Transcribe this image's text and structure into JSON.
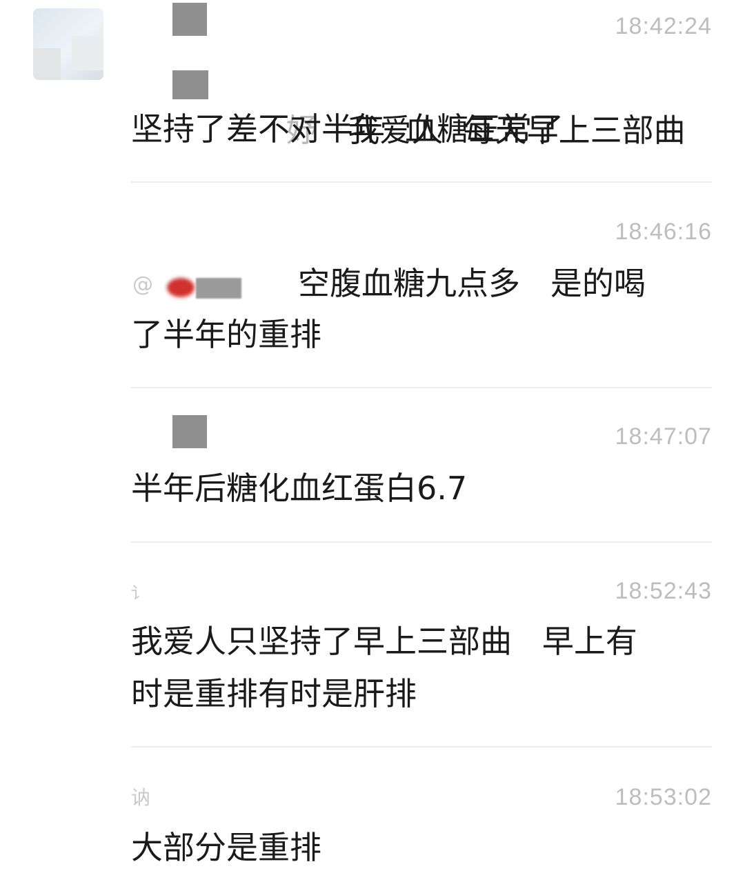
{
  "messages": [
    {
      "time": "18:42:24",
      "name_fragment": "妤",
      "line1": "我爱人  每天早上三部曲",
      "line2": "坚持了差不对半年  血糖正常了"
    },
    {
      "time": "18:46:16",
      "mention_prefix": "@",
      "line1": "空腹血糖九点多   是的喝",
      "line2": "了半年的重排"
    },
    {
      "time": "18:47:07",
      "line1": "半年后糖化血红蛋白6.7"
    },
    {
      "time": "18:52:43",
      "name_fragment": "讠",
      "line1": "我爱人只坚持了早上三部曲   早上有",
      "line2": "时是重排有时是肝排"
    },
    {
      "time": "18:53:02",
      "name_fragment": "讷",
      "line1": "大部分是重排"
    }
  ]
}
